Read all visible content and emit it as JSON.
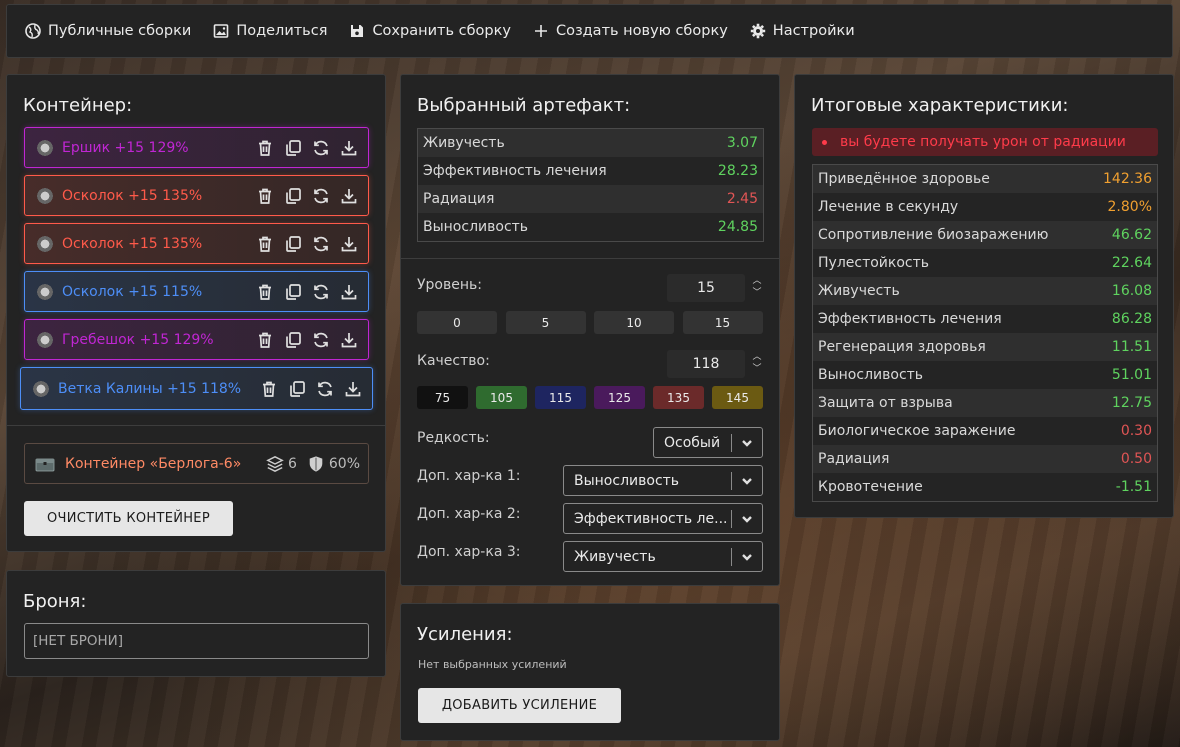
{
  "topbar": {
    "items": [
      {
        "label": "Публичные сборки",
        "icon": "globe-icon"
      },
      {
        "label": "Поделиться",
        "icon": "image-icon"
      },
      {
        "label": "Сохранить сборку",
        "icon": "save-icon"
      },
      {
        "label": "Создать новую сборку",
        "icon": "plus-icon"
      },
      {
        "label": "Настройки",
        "icon": "gear-icon"
      }
    ]
  },
  "container": {
    "title": "Контейнер:",
    "artifacts": [
      {
        "name": "Ершик +15 129%",
        "color": "#c026d3"
      },
      {
        "name": "Осколок +15 135%",
        "color": "#ff5a4a"
      },
      {
        "name": "Осколок +15 135%",
        "color": "#ff5a4a"
      },
      {
        "name": "Осколок +15 115%",
        "color": "#4d8ef7"
      },
      {
        "name": "Гребешок +15 129%",
        "color": "#c026d3"
      },
      {
        "name": "Ветка Калины +15 118%",
        "color": "#4d8ef7"
      }
    ],
    "box": {
      "name": "Контейнер «Берлога-6»",
      "slots": "6",
      "protection": "60%"
    },
    "clear_label": "ОЧИСТИТЬ КОНТЕЙНЕР"
  },
  "armor": {
    "title": "Броня:",
    "value": "[НЕТ БРОНИ]"
  },
  "artifact": {
    "title": "Выбранный артефакт:",
    "stats": [
      {
        "name": "Живучесть",
        "value": "3.07",
        "tone": "green"
      },
      {
        "name": "Эффективность лечения",
        "value": "28.23",
        "tone": "green"
      },
      {
        "name": "Радиация",
        "value": "2.45",
        "tone": "red"
      },
      {
        "name": "Выносливость",
        "value": "24.85",
        "tone": "green"
      }
    ],
    "level_label": "Уровень:",
    "level_value": "15",
    "level_presets": [
      "0",
      "5",
      "10",
      "15"
    ],
    "quality_label": "Качество:",
    "quality_value": "118",
    "quality_presets": [
      {
        "label": "75",
        "color": "#111111"
      },
      {
        "label": "105",
        "color": "#2f6b2f"
      },
      {
        "label": "115",
        "color": "#1e2560"
      },
      {
        "label": "125",
        "color": "#4a1a5c"
      },
      {
        "label": "135",
        "color": "#6b2a2a"
      },
      {
        "label": "145",
        "color": "#6b5a12"
      }
    ],
    "rarity_label": "Редкость:",
    "rarity_value": "Особый",
    "extra1_label": "Доп. хар-ка 1:",
    "extra1_value": "Выносливость",
    "extra2_label": "Доп. хар-ка 2:",
    "extra2_value": "Эффективность ле...",
    "extra3_label": "Доп. хар-ка 3:",
    "extra3_value": "Живучесть"
  },
  "boosts": {
    "title": "Усиления:",
    "note": "Нет выбранных усилений",
    "add_label": "ДОБАВИТЬ УСИЛЕНИЕ"
  },
  "totals": {
    "title": "Итоговые характеристики:",
    "warning": "вы будете получать урон от радиации",
    "stats": [
      {
        "name": "Приведённое здоровье",
        "value": "142.36",
        "tone": "orange"
      },
      {
        "name": "Лечение в секунду",
        "value": "2.80%",
        "tone": "orange"
      },
      {
        "name": "Сопротивление биозаражению",
        "value": "46.62",
        "tone": "green"
      },
      {
        "name": "Пулестойкость",
        "value": "22.64",
        "tone": "green"
      },
      {
        "name": "Живучесть",
        "value": "16.08",
        "tone": "green"
      },
      {
        "name": "Эффективность лечения",
        "value": "86.28",
        "tone": "green"
      },
      {
        "name": "Регенерация здоровья",
        "value": "11.51",
        "tone": "green"
      },
      {
        "name": "Выносливость",
        "value": "51.01",
        "tone": "green"
      },
      {
        "name": "Защита от взрыва",
        "value": "12.75",
        "tone": "green"
      },
      {
        "name": "Биологическое заражение",
        "value": "0.30",
        "tone": "red"
      },
      {
        "name": "Радиация",
        "value": "0.50",
        "tone": "red"
      },
      {
        "name": "Кровотечение",
        "value": "-1.51",
        "tone": "green"
      }
    ]
  }
}
